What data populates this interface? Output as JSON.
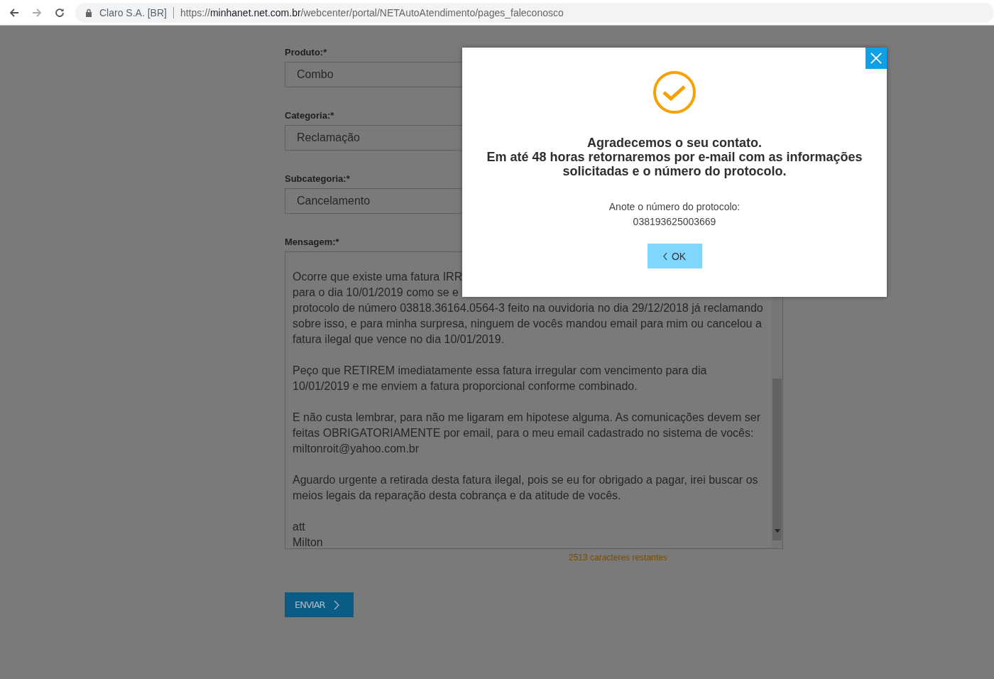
{
  "browser": {
    "site_name": "Claro S.A. [BR]",
    "url_scheme": "https://",
    "url_host": "minhanet.net.com.br",
    "url_path": "/webcenter/portal/NETAutoAtendimento/pages_faleconosco"
  },
  "form": {
    "fields": [
      {
        "label": "Produto:*",
        "value": "Combo"
      },
      {
        "label": "Categoria:*",
        "value": "Reclamação"
      },
      {
        "label": "Subcategoria:*",
        "value": "Cancelamento"
      }
    ],
    "message": {
      "label": "Mensagem:*",
      "paragraphs": [
        [
          "Ocorre que existe uma fatura IRR",
          "para o dia 10/01/2019 como se e",
          "protocolo de número 03818.36164.0564-3 feito na ouvidoria no dia 29/12/2018 já reclamando",
          "sobre isso, e para minha surpresa, ninguem de vocês mandou email para mim ou cancelou a",
          "fatura ilegal que vence no dia 10/01/2019."
        ],
        [
          "Peço que RETIREM imediatamente essa fatura irregular com vencimento para dia",
          "10/01/2019 e me enviem a fatura proporcional conforme combinado."
        ],
        [
          "E não custa lembrar, para não me ligaram em hipotese alguma. As comunicações devem ser",
          "feitas OBRIGATORIAMENTE por email, para o meu email cadastrado no sistema de vocês:",
          "miltonroit@yahoo.com.br"
        ],
        [
          "Aguardo urgente a retirada desta fatura ilegal, pois se eu for obrigado a pagar, irei buscar os",
          "meios legais da reparação desta cobrança e da atitude de vocês."
        ],
        [
          "att",
          "Milton"
        ]
      ]
    },
    "counter": "2513 caracteres restantes",
    "submit": "ENVIAR"
  },
  "dialog": {
    "heading": [
      "Agradecemos o seu contato.",
      "Em até 48 horas retornaremos por e-mail com as informações solicitadas e o número do protocolo."
    ],
    "note": "Anote o número do protocolo:",
    "protocol": "038193625003669",
    "ok": "OK"
  }
}
